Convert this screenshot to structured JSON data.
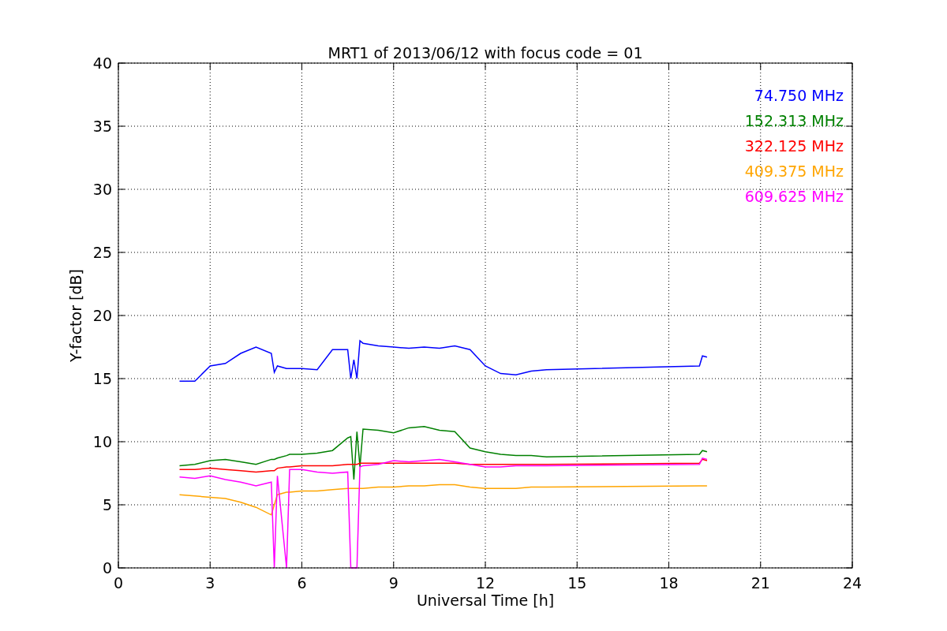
{
  "figure": {
    "chart_data": {
      "type": "line",
      "title": "MRT1 of 2013/06/12 with focus code = 01",
      "xlabel": "Universal Time [h]",
      "ylabel": "Y-factor [dB]",
      "x": [
        2,
        2.5,
        3,
        3.5,
        4,
        4.5,
        5,
        5.1,
        5.2,
        5.5,
        5.6,
        6,
        6.5,
        7,
        7.5,
        7.6,
        7.7,
        7.8,
        7.9,
        8,
        8.5,
        9,
        9.5,
        10,
        10.5,
        11,
        11.5,
        12,
        12.5,
        13,
        13.5,
        14,
        19,
        19.1,
        19.25
      ],
      "series": [
        {
          "name": "74.750 MHz",
          "color": "#0000ff",
          "values": [
            14.8,
            14.8,
            16,
            16.2,
            17,
            17.5,
            17,
            15.5,
            16,
            15.8,
            15.8,
            15.8,
            15.7,
            17.3,
            17.3,
            15,
            16.5,
            15,
            18,
            17.8,
            17.6,
            17.5,
            17.4,
            17.5,
            17.4,
            17.6,
            17.3,
            16,
            15.4,
            15.3,
            15.6,
            15.7,
            16,
            16.8,
            16.7
          ]
        },
        {
          "name": "152.313 MHz",
          "color": "#008000",
          "values": [
            8.1,
            8.2,
            8.5,
            8.6,
            8.4,
            8.2,
            8.6,
            8.6,
            8.7,
            8.9,
            9,
            9,
            9.1,
            9.3,
            10.3,
            10.4,
            7,
            10.8,
            8,
            11,
            10.9,
            10.7,
            11.1,
            11.2,
            10.9,
            10.8,
            9.5,
            9.2,
            9,
            8.9,
            8.9,
            8.8,
            9,
            9.3,
            9.2
          ]
        },
        {
          "name": "322.125 MHz",
          "color": "#ff0000",
          "values": [
            7.8,
            7.8,
            7.9,
            7.8,
            7.7,
            7.6,
            7.7,
            7.7,
            7.9,
            8,
            8,
            8.1,
            8.1,
            8.1,
            8.2,
            8.2,
            8.2,
            8.2,
            8.3,
            8.3,
            8.3,
            8.3,
            8.3,
            8.3,
            8.3,
            8.3,
            8.2,
            8.2,
            8.2,
            8.2,
            8.2,
            8.2,
            8.3,
            8.6,
            8.5
          ]
        },
        {
          "name": "409.375 MHz",
          "color": "#ffa500",
          "values": [
            5.8,
            5.7,
            5.6,
            5.5,
            5.2,
            4.8,
            4.2,
            5,
            5.8,
            6,
            6,
            6.1,
            6.1,
            6.2,
            6.3,
            6.3,
            6.3,
            6.3,
            6.3,
            6.3,
            6.4,
            6.4,
            6.5,
            6.5,
            6.6,
            6.6,
            6.4,
            6.3,
            6.3,
            6.3,
            6.4,
            6.4,
            6.5,
            6.5,
            6.5
          ]
        },
        {
          "name": "609.625 MHz",
          "color": "#ff00ff",
          "values": [
            7.2,
            7.1,
            7.3,
            7,
            6.8,
            6.5,
            6.8,
            0,
            7.3,
            0,
            7.8,
            7.8,
            7.6,
            7.5,
            7.6,
            0,
            0,
            0,
            8,
            8.1,
            8.2,
            8.5,
            8.4,
            8.5,
            8.6,
            8.4,
            8.2,
            8,
            8,
            8.1,
            8.1,
            8.1,
            8.2,
            8.7,
            8.6
          ]
        }
      ],
      "grid": true,
      "xlim": [
        0,
        24
      ],
      "ylim": [
        0,
        40
      ],
      "xticks": [
        0,
        3,
        6,
        9,
        12,
        15,
        18,
        21,
        24
      ],
      "yticks": [
        0,
        5,
        10,
        15,
        20,
        25,
        30,
        35,
        40
      ]
    }
  }
}
